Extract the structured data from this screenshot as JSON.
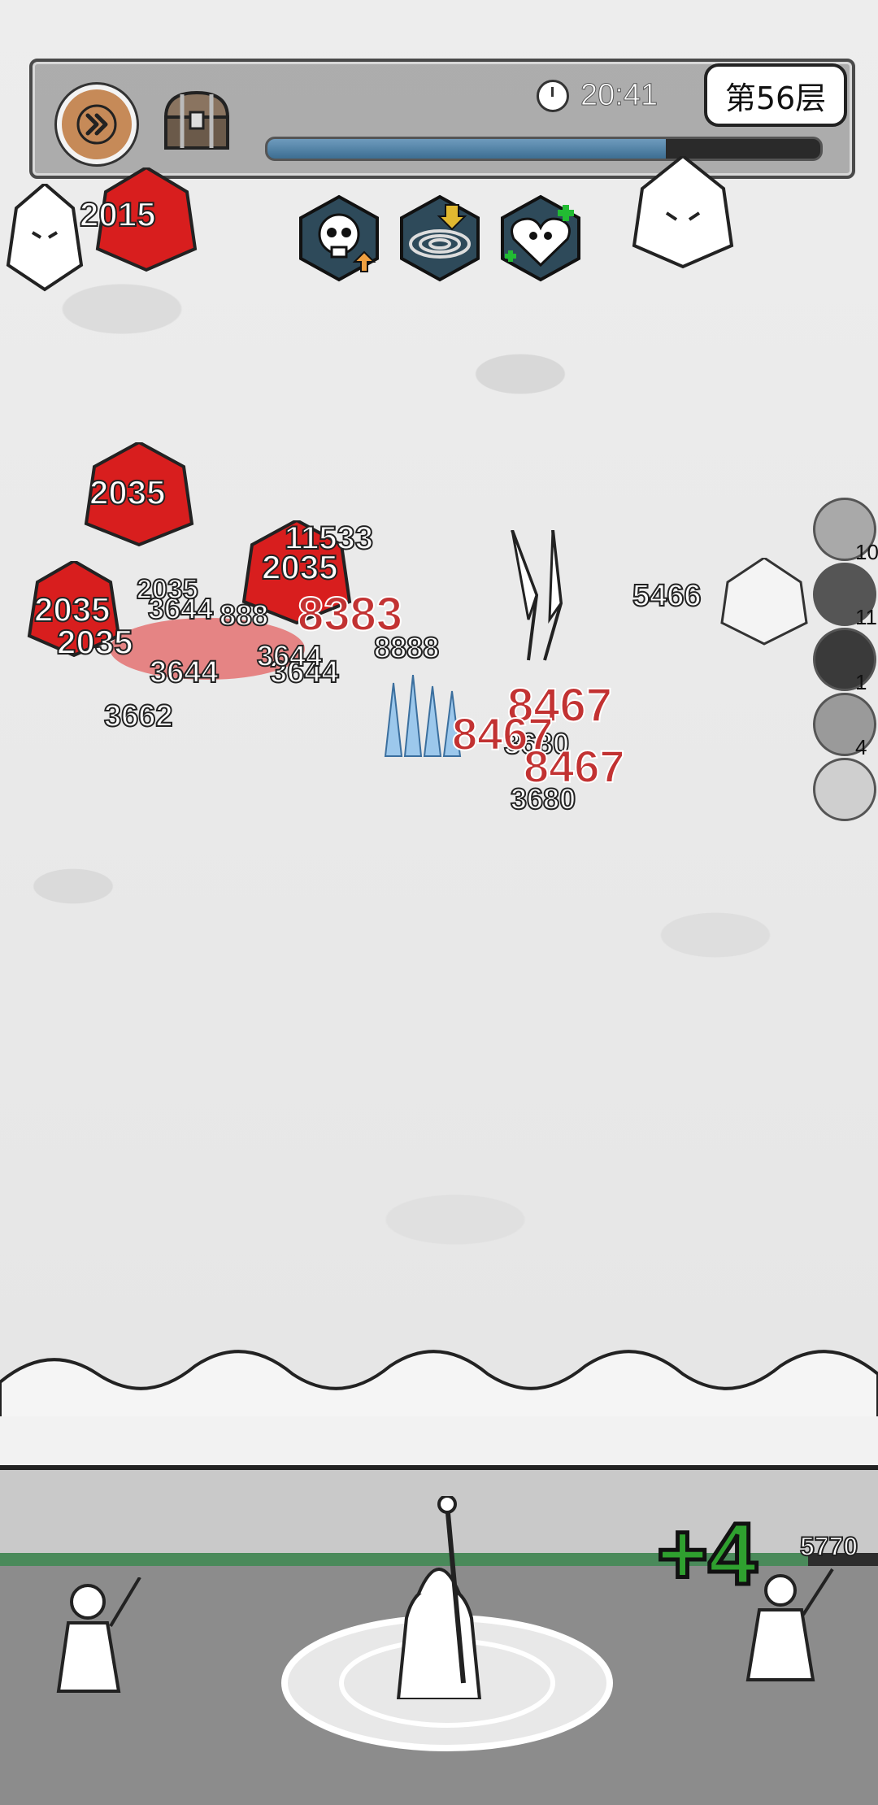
{
  "hud": {
    "timer": "20:41",
    "floor": "第56层",
    "wave_progress": 0.72
  },
  "icons": {
    "speed": "fast-forward-icon",
    "chest": "treasure-chest-icon",
    "clock": "clock-icon",
    "buffs": [
      "skull-up-buff-icon",
      "vortex-down-buff-icon",
      "skull-heart-heal-buff-icon"
    ]
  },
  "monsters": {
    "hp_labels": [
      "2015",
      "2035",
      "2035",
      "2035",
      "2035"
    ]
  },
  "damage_numbers": {
    "white": [
      "11533",
      "3644",
      "888",
      "3644",
      "3644",
      "3662",
      "5466",
      "3680",
      "3680",
      "8888",
      "3644",
      "2035"
    ],
    "red": [
      "8383",
      "8467",
      "8467",
      "8467"
    ]
  },
  "side_skills": [
    {
      "icon": "crystal-skill-icon",
      "count": "10"
    },
    {
      "icon": "bomb-skill-icon",
      "count": "11"
    },
    {
      "icon": "dark-vortex-skill-icon",
      "count": "1"
    },
    {
      "icon": "lightning-skill-icon",
      "count": "4"
    },
    {
      "icon": "empty-skill-slot",
      "count": ""
    }
  ],
  "wall": {
    "hp": "5770",
    "hp_fraction": 0.92,
    "gain": "+4"
  },
  "colors": {
    "enemy_red": "#d81e1e",
    "speed_button": "#c68a58",
    "hp_bar": "#4a8a5a",
    "gain_text": "#2fa02f"
  }
}
